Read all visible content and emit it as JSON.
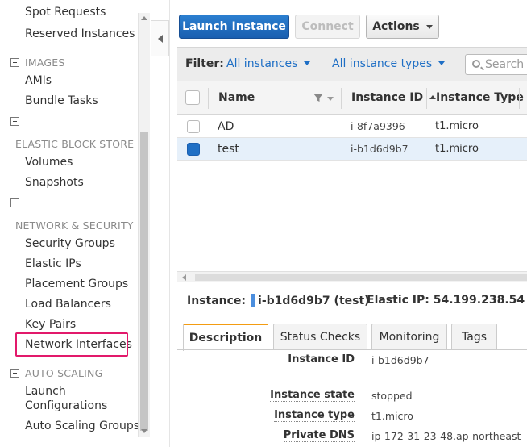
{
  "sidebar": {
    "items_top": [
      {
        "label": "Spot Requests"
      },
      {
        "label": "Reserved Instances"
      }
    ],
    "images": {
      "title": "IMAGES",
      "items": [
        "AMIs",
        "Bundle Tasks"
      ]
    },
    "ebs": {
      "title": "ELASTIC BLOCK STORE",
      "items": [
        "Volumes",
        "Snapshots"
      ]
    },
    "network": {
      "title": "NETWORK & SECURITY",
      "items": [
        "Security Groups",
        "Elastic IPs",
        "Placement Groups",
        "Load Balancers",
        "Key Pairs",
        "Network Interfaces"
      ]
    },
    "autoscaling": {
      "title": "AUTO SCALING",
      "items": [
        "Launch",
        "Configurations",
        "Auto Scaling Groups"
      ]
    }
  },
  "toolbar": {
    "launch_label": "Launch Instance",
    "connect_label": "Connect",
    "actions_label": "Actions"
  },
  "filter": {
    "label": "Filter:",
    "instances": "All instances",
    "types": "All instance types",
    "search_placeholder": "Search I"
  },
  "table": {
    "columns": [
      "Name",
      "Instance ID",
      "Instance Type"
    ],
    "rows": [
      {
        "name": "AD",
        "id": "i-8f7a9396",
        "type": "t1.micro",
        "selected": false
      },
      {
        "name": "test",
        "id": "i-b1d6d9b7",
        "type": "t1.micro",
        "selected": true
      }
    ]
  },
  "detail": {
    "instance_label": "Instance:",
    "instance_value": "i-b1d6d9b7 (test)",
    "elastic_ip": "Elastic IP: 54.199.238.54",
    "tabs": [
      "Description",
      "Status Checks",
      "Monitoring",
      "Tags"
    ],
    "fields": [
      {
        "label": "Instance ID",
        "value": "i-b1d6d9b7"
      },
      {
        "label": "Instance state",
        "value": "stopped"
      },
      {
        "label": "Instance type",
        "value": "t1.micro"
      },
      {
        "label": "Private DNS",
        "value": "ip-172-31-23-48.ap-northeast-"
      }
    ]
  },
  "colors": {
    "primary_button": "#1f6fc5",
    "highlight": "#e2196b",
    "active_tab_accent": "#f39c12"
  }
}
